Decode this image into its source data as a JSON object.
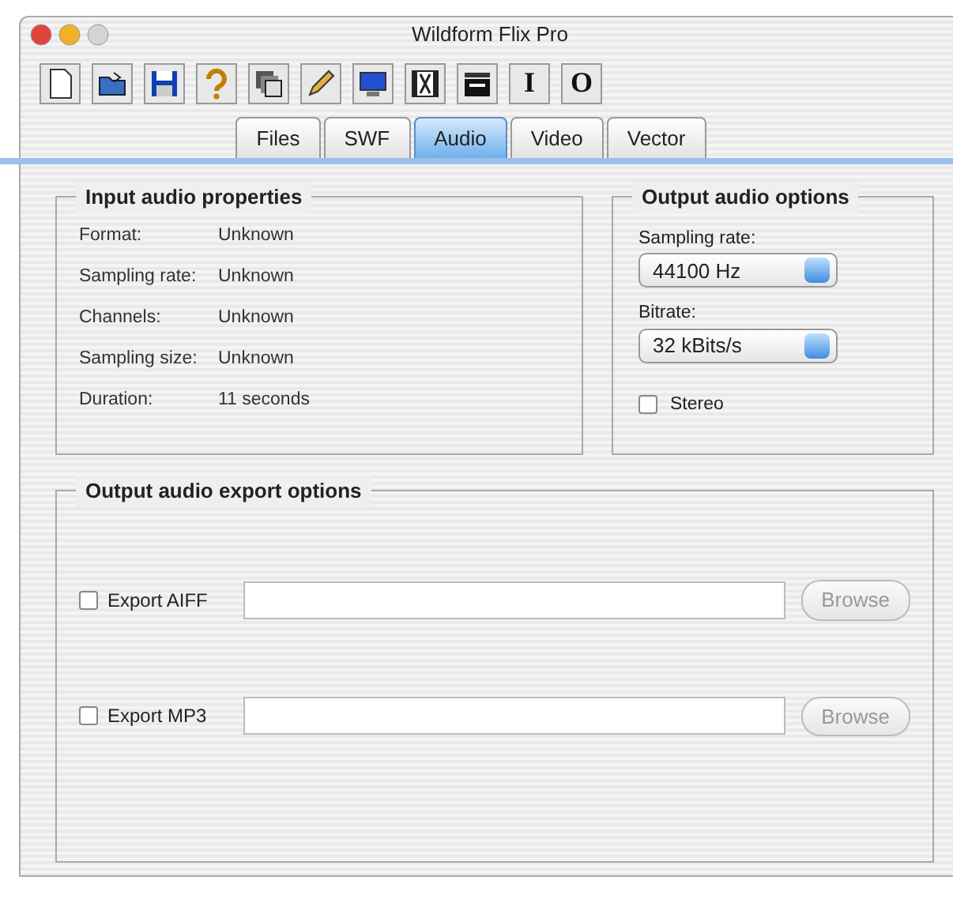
{
  "window": {
    "title": "Wildform Flix Pro"
  },
  "toolbar": {
    "text_buttons": [
      "I",
      "O"
    ]
  },
  "tabs": [
    {
      "label": "Files",
      "selected": false
    },
    {
      "label": "SWF",
      "selected": false
    },
    {
      "label": "Audio",
      "selected": true
    },
    {
      "label": "Video",
      "selected": false
    },
    {
      "label": "Vector",
      "selected": false
    }
  ],
  "input_audio_properties": {
    "title": "Input audio properties",
    "rows": [
      {
        "label": "Format:",
        "value": "Unknown"
      },
      {
        "label": "Sampling rate:",
        "value": "Unknown"
      },
      {
        "label": "Channels:",
        "value": "Unknown"
      },
      {
        "label": "Sampling size:",
        "value": "Unknown"
      },
      {
        "label": "Duration:",
        "value": "11 seconds"
      }
    ]
  },
  "output_audio_options": {
    "title": "Output audio options",
    "selects": [
      {
        "label": "Sampling rate:",
        "value": "44100 Hz"
      },
      {
        "label": "Bitrate:",
        "value": "32 kBits/s"
      }
    ],
    "stereo": {
      "label": "Stereo",
      "checked": false
    }
  },
  "output_audio_export_options": {
    "title": "Output audio export options",
    "rows": [
      {
        "label": "Export AIFF",
        "checked": false,
        "browse": {
          "label": "Browse",
          "disabled": true
        }
      },
      {
        "label": "Export MP3",
        "checked": false,
        "browse": {
          "label": "Browse",
          "disabled": true
        }
      }
    ]
  }
}
